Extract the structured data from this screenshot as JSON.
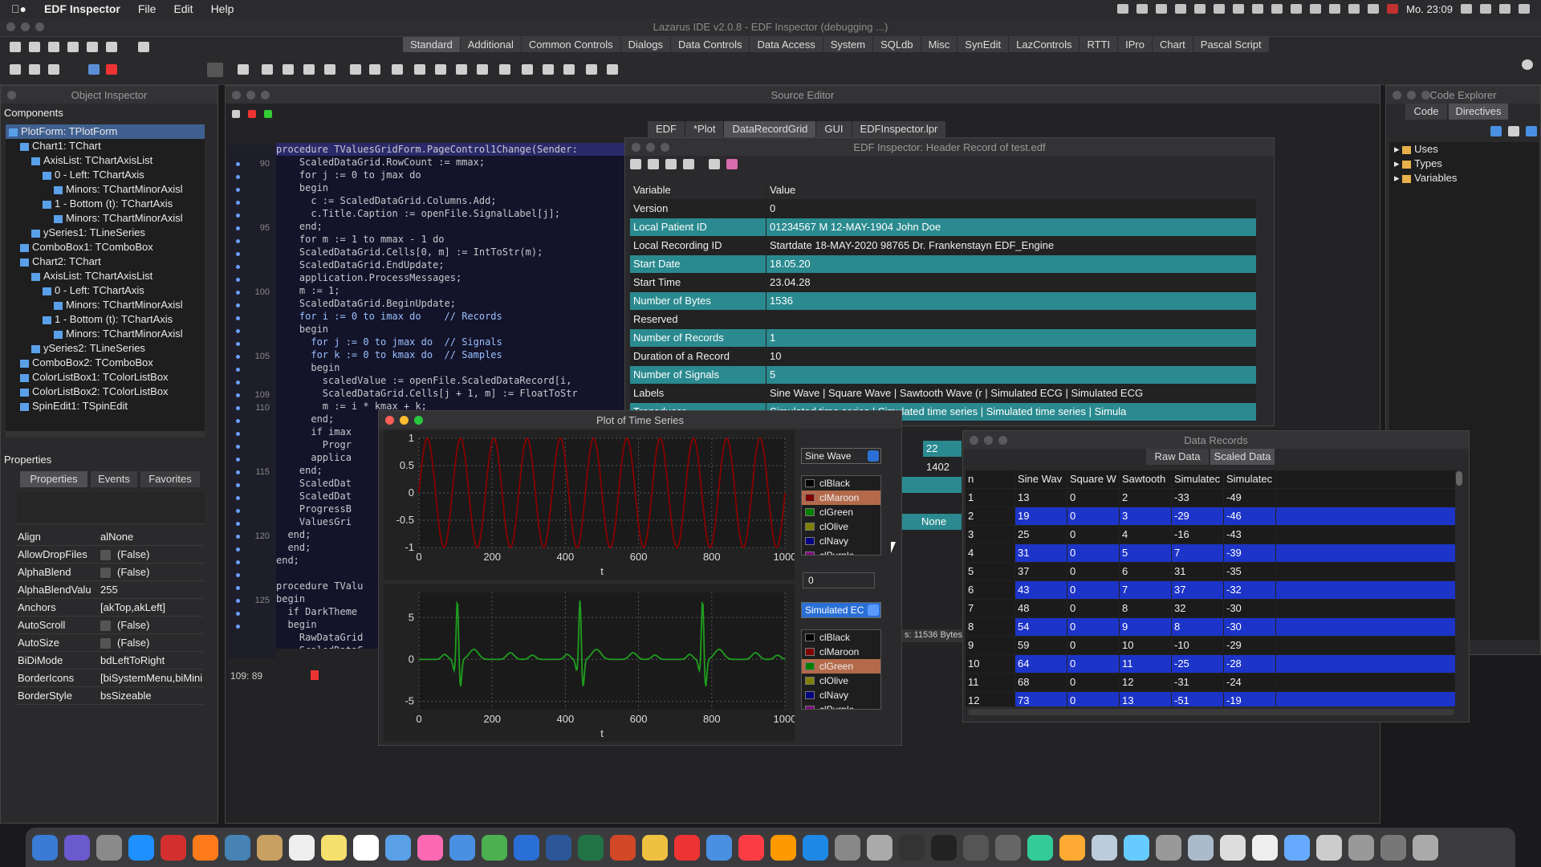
{
  "menubar": {
    "apple": "",
    "app_name": "EDF Inspector",
    "items": [
      "File",
      "Edit",
      "Help"
    ],
    "clock": "Mo. 23:09"
  },
  "ide": {
    "title": "Lazarus IDE v2.0.8 - EDF Inspector (debugging ...)",
    "palette_tabs": [
      "Standard",
      "Additional",
      "Common Controls",
      "Dialogs",
      "Data Controls",
      "Data Access",
      "System",
      "SQLdb",
      "Misc",
      "SynEdit",
      "LazControls",
      "RTTI",
      "IPro",
      "Chart",
      "Pascal Script"
    ]
  },
  "object_inspector": {
    "title": "Object Inspector",
    "components_label": "Components",
    "tree": [
      {
        "label": "PlotForm: TPlotForm",
        "indent": 0,
        "selected": true
      },
      {
        "label": "Chart1: TChart",
        "indent": 1
      },
      {
        "label": "AxisList: TChartAxisList",
        "indent": 2
      },
      {
        "label": "0 - Left: TChartAxis",
        "indent": 3
      },
      {
        "label": "Minors: TChartMinorAxisl",
        "indent": 4
      },
      {
        "label": "1 - Bottom (t): TChartAxis",
        "indent": 3
      },
      {
        "label": "Minors: TChartMinorAxisl",
        "indent": 4
      },
      {
        "label": "ySeries1: TLineSeries",
        "indent": 2
      },
      {
        "label": "ComboBox1: TComboBox",
        "indent": 1
      },
      {
        "label": "Chart2: TChart",
        "indent": 1
      },
      {
        "label": "AxisList: TChartAxisList",
        "indent": 2
      },
      {
        "label": "0 - Left: TChartAxis",
        "indent": 3
      },
      {
        "label": "Minors: TChartMinorAxisl",
        "indent": 4
      },
      {
        "label": "1 - Bottom (t): TChartAxis",
        "indent": 3
      },
      {
        "label": "Minors: TChartMinorAxisl",
        "indent": 4
      },
      {
        "label": "ySeries2: TLineSeries",
        "indent": 2
      },
      {
        "label": "ComboBox2: TComboBox",
        "indent": 1
      },
      {
        "label": "ColorListBox1: TColorListBox",
        "indent": 1
      },
      {
        "label": "ColorListBox2: TColorListBox",
        "indent": 1
      },
      {
        "label": "SpinEdit1: TSpinEdit",
        "indent": 1
      }
    ],
    "properties_label": "Properties",
    "tabs": [
      "Properties",
      "Events",
      "Favorites"
    ],
    "props": [
      {
        "name": "Align",
        "value": "alNone"
      },
      {
        "name": "AllowDropFiles",
        "value": "(False)",
        "check": true
      },
      {
        "name": "AlphaBlend",
        "value": "(False)",
        "check": true
      },
      {
        "name": "AlphaBlendValu",
        "value": "255"
      },
      {
        "name": "Anchors",
        "value": "[akTop,akLeft]"
      },
      {
        "name": "AutoScroll",
        "value": "(False)",
        "check": true
      },
      {
        "name": "AutoSize",
        "value": "(False)",
        "check": true
      },
      {
        "name": "BiDiMode",
        "value": "bdLeftToRight"
      },
      {
        "name": "BorderIcons",
        "value": "[biSystemMenu,biMini"
      },
      {
        "name": "BorderStyle",
        "value": "bsSizeable"
      }
    ]
  },
  "source_editor": {
    "title": "Source Editor",
    "tabs": [
      "EDF",
      "*Plot",
      "DataRecordGrid",
      "GUI",
      "EDFInspector.lpr"
    ],
    "status": "109: 89",
    "line_numbers": [
      "90",
      "",
      "",
      "",
      "",
      "95",
      "",
      "",
      "",
      "",
      "100",
      "",
      "",
      "",
      "",
      "105",
      "",
      "",
      "109",
      "110",
      "",
      "",
      "",
      "",
      "115",
      "",
      "",
      "",
      "",
      "120",
      "",
      "",
      "",
      "",
      "125",
      "",
      ""
    ],
    "code": [
      "procedure TValuesGridForm.PageControl1Change(Sender:",
      "    ScaledDataGrid.RowCount := mmax;",
      "    for j := 0 to jmax do",
      "    begin",
      "      c := ScaledDataGrid.Columns.Add;",
      "      c.Title.Caption := openFile.SignalLabel[j];",
      "    end;",
      "    for m := 1 to mmax - 1 do",
      "    ScaledDataGrid.Cells[0, m] := IntToStr(m);",
      "    ScaledDataGrid.EndUpdate;",
      "    application.ProcessMessages;",
      "    m := 1;",
      "    ScaledDataGrid.BeginUpdate;",
      "    for i := 0 to imax do    // Records",
      "    begin",
      "      for j := 0 to jmax do  // Signals",
      "      for k := 0 to kmax do  // Samples",
      "      begin",
      "        scaledValue := openFile.ScaledDataRecord[i,",
      "        ScaledDataGrid.Cells[j + 1, m] := FloatToStr",
      "        m := i * kmax + k;",
      "      end;",
      "      if imax",
      "        Progr",
      "      applica",
      "    end;",
      "    ScaledDat",
      "    ScaledDat",
      "    ProgressB",
      "    ValuesGri",
      "  end;",
      "  end;",
      "end;",
      "",
      "procedure TValu",
      "begin",
      "  if DarkTheme",
      "  begin",
      "    RawDataGrid",
      "    ScaledDataG"
    ]
  },
  "header_record": {
    "title": "EDF Inspector: Header Record of test.edf",
    "col_variable": "Variable",
    "col_value": "Value",
    "rows": [
      {
        "k": "Version",
        "v": "0"
      },
      {
        "k": "Local Patient ID",
        "v": "01234567 M 12-MAY-1904 John Doe"
      },
      {
        "k": "Local Recording ID",
        "v": "Startdate 18-MAY-2020 98765 Dr. Frankenstayn EDF_Engine"
      },
      {
        "k": "Start Date",
        "v": "18.05.20"
      },
      {
        "k": "Start Time",
        "v": "23.04.28"
      },
      {
        "k": "Number of Bytes",
        "v": "1536"
      },
      {
        "k": "Reserved",
        "v": ""
      },
      {
        "k": "Number of Records",
        "v": "1"
      },
      {
        "k": "Duration of a Record",
        "v": "10"
      },
      {
        "k": "Number of Signals",
        "v": "5"
      },
      {
        "k": "Labels",
        "v": "Sine Wave | Square Wave | Sawtooth Wave (r | Simulated ECG | Simulated ECG"
      },
      {
        "k": "Transducer",
        "v": "Simulated time series | Simulated time series | Simulated time series | Simula"
      }
    ],
    "partial_vals": [
      "22",
      "1402",
      "None"
    ],
    "bytes_status": "s: 11536 Bytes"
  },
  "plot_window": {
    "title": "Plot of Time Series",
    "combo1": "Sine Wave",
    "combo2": "Simulated EC",
    "spin_value": "0",
    "colors": [
      {
        "name": "clBlack",
        "hex": "#000000"
      },
      {
        "name": "clMaroon",
        "hex": "#800000"
      },
      {
        "name": "clGreen",
        "hex": "#008000"
      },
      {
        "name": "clOlive",
        "hex": "#808000"
      },
      {
        "name": "clNavy",
        "hex": "#000080"
      },
      {
        "name": "clPurple",
        "hex": "#800080"
      }
    ],
    "list1_selected": "clMaroon",
    "list2_selected": "clGreen"
  },
  "chart_data": [
    {
      "type": "line",
      "xlabel": "t",
      "ylabel": "",
      "xlim": [
        0,
        1000
      ],
      "ylim": [
        -1,
        1
      ],
      "xticks": [
        "0",
        "200",
        "400",
        "600",
        "800",
        "1000"
      ],
      "yticks": [
        "1",
        "0.5",
        "0",
        "-0.5",
        "-1"
      ],
      "series": [
        {
          "color": "#8b0000",
          "kind": "sine",
          "cycles": 11
        }
      ],
      "grid": true
    },
    {
      "type": "line",
      "xlabel": "t",
      "ylabel": "",
      "xlim": [
        0,
        1000
      ],
      "ylim": [
        -6,
        8
      ],
      "xticks": [
        "0",
        "200",
        "400",
        "600",
        "800",
        "1000"
      ],
      "yticks": [
        "5",
        "0",
        "-5"
      ],
      "series": [
        {
          "color": "#1e9e1e",
          "kind": "ecg",
          "beats_x": [
            105,
            440,
            775
          ]
        }
      ],
      "grid": true
    }
  ],
  "data_records": {
    "title": "Data Records",
    "tabs": [
      "Raw Data",
      "Scaled Data"
    ],
    "headers": [
      "n",
      "Sine Wav",
      "Square W",
      "Sawtooth",
      "Simulatec",
      "Simulatec"
    ],
    "rows": [
      [
        "1",
        "13",
        "0",
        "2",
        "-33",
        "-49"
      ],
      [
        "2",
        "19",
        "0",
        "3",
        "-29",
        "-46"
      ],
      [
        "3",
        "25",
        "0",
        "4",
        "-16",
        "-43"
      ],
      [
        "4",
        "31",
        "0",
        "5",
        "7",
        "-39"
      ],
      [
        "5",
        "37",
        "0",
        "6",
        "31",
        "-35"
      ],
      [
        "6",
        "43",
        "0",
        "7",
        "37",
        "-32"
      ],
      [
        "7",
        "48",
        "0",
        "8",
        "32",
        "-30"
      ],
      [
        "8",
        "54",
        "0",
        "9",
        "8",
        "-30"
      ],
      [
        "9",
        "59",
        "0",
        "10",
        "-10",
        "-29"
      ],
      [
        "10",
        "64",
        "0",
        "11",
        "-25",
        "-28"
      ],
      [
        "11",
        "68",
        "0",
        "12",
        "-31",
        "-24"
      ],
      [
        "12",
        "73",
        "0",
        "13",
        "-51",
        "-19"
      ]
    ]
  },
  "code_explorer": {
    "title": "Code Explorer",
    "tabs": [
      "Code",
      "Directives"
    ],
    "items": [
      "Uses",
      "Types",
      "Variables"
    ]
  }
}
